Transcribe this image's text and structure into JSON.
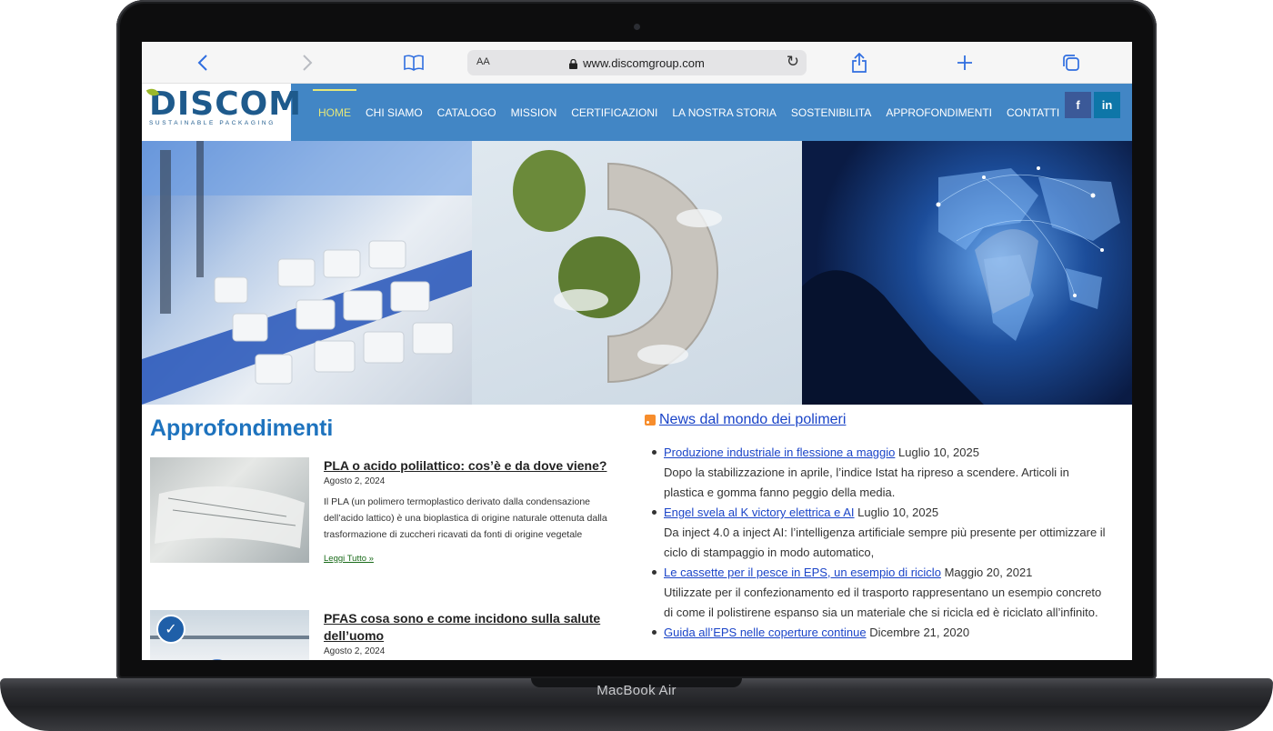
{
  "device": {
    "label": "MacBook Air"
  },
  "browser": {
    "url": "www.discomgroup.com",
    "text_size_label": "AA"
  },
  "site": {
    "logo": {
      "name": "DISCOM",
      "tagline": "SUSTAINABLE PACKAGING"
    },
    "nav": [
      {
        "label": "HOME",
        "active": true
      },
      {
        "label": "CHI SIAMO"
      },
      {
        "label": "CATALOGO"
      },
      {
        "label": "MISSION"
      },
      {
        "label": "CERTIFICAZIONI"
      },
      {
        "label": "LA NOSTRA STORIA"
      },
      {
        "label": "SOSTENIBILITA"
      },
      {
        "label": "APPROFONDIMENTI"
      },
      {
        "label": "CONTATTI"
      }
    ],
    "social": {
      "facebook": "f",
      "linkedin": "in"
    }
  },
  "approfondimenti": {
    "title": "Approfondimenti",
    "articles": [
      {
        "title": "PLA o acido polilattico: cos’è e da dove viene?",
        "date": "Agosto 2, 2024",
        "excerpt": "Il PLA (un polimero termoplastico derivato dalla condensazione dell’acido lattico) è una bioplastica di origine naturale ottenuta dalla trasformazione di zuccheri ricavati da fonti di origine vegetale",
        "read_more": "Leggi Tutto »"
      },
      {
        "title": "PFAS cosa sono e come incidono sulla salute dell’uomo",
        "date": "Agosto 2, 2024"
      }
    ]
  },
  "news": {
    "title": "News dal mondo dei polimeri",
    "items": [
      {
        "link": "Produzione industriale in flessione a maggio",
        "date": "Luglio 10, 2025",
        "summary": "Dopo la stabilizzazione in aprile, l’indice Istat ha ripreso a scendere. Articoli in plastica e gomma fanno peggio della media."
      },
      {
        "link": "Engel svela al K victory elettrica e AI",
        "date": "Luglio 10, 2025",
        "summary": "Da inject 4.0 a inject AI: l’intelligenza artificiale sempre più presente per ottimizzare il ciclo di stampaggio in modo automatico,"
      },
      {
        "link": "Le cassette per il pesce in EPS, un esempio di riciclo",
        "date": "Maggio 20, 2021",
        "summary": "Utilizzate per il confezionamento ed il trasporto rappresentano un esempio concreto di come il polistirene espanso sia un materiale che si ricicla ed è riciclato all’infinito."
      },
      {
        "link": "Guida all’EPS nelle coperture continue",
        "date": "Dicembre 21, 2020",
        "summary": ""
      }
    ]
  },
  "colors": {
    "header_blue": "#4286c5",
    "nav_active": "#e5e77a",
    "title_blue": "#1e73be",
    "link_blue": "#1a44c8"
  }
}
